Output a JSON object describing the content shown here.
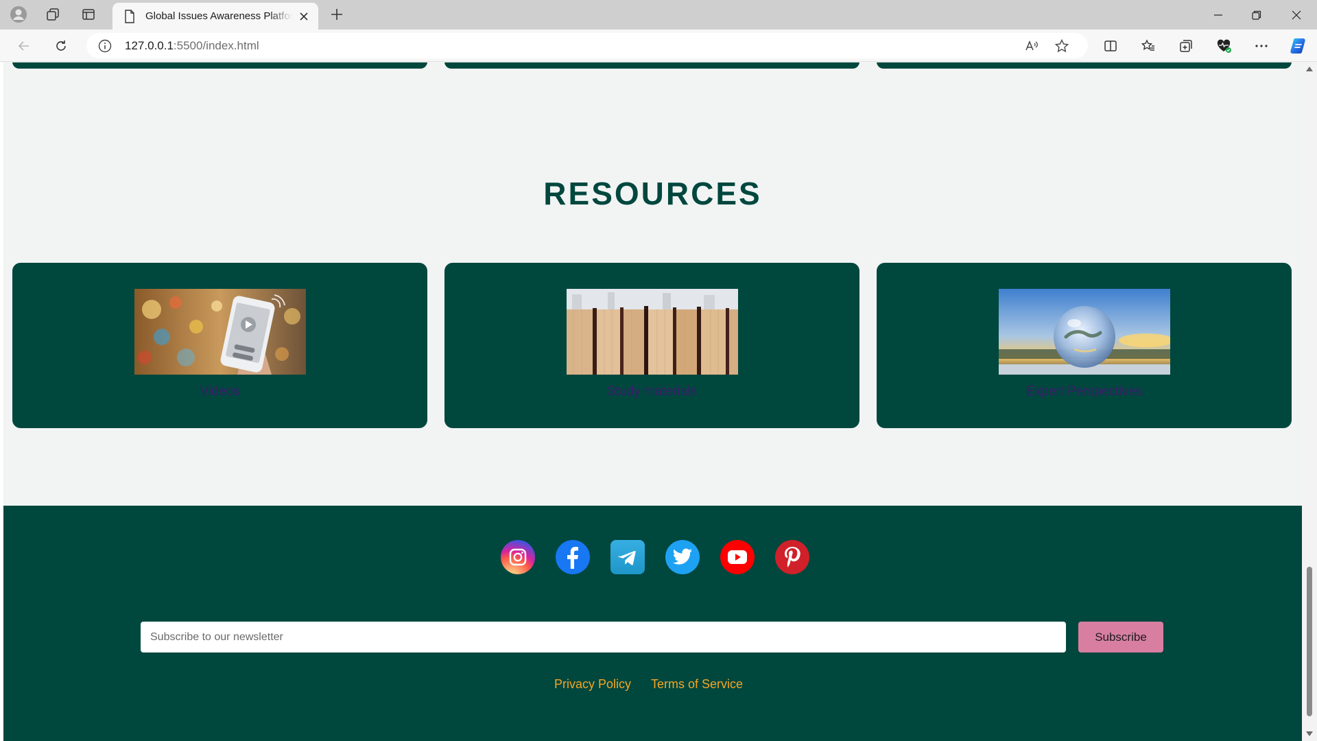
{
  "browser": {
    "tab_title": "Global Issues Awareness Platform",
    "url_host": "127.0.0.1",
    "url_rest": ":5500/index.html"
  },
  "resources": {
    "heading": "RESOURCES",
    "cards": [
      {
        "label": "Videos",
        "image": "phone-video-photo"
      },
      {
        "label": "Study materials",
        "image": "books-photo"
      },
      {
        "label": "Expert Perspectives",
        "image": "glass-globe-photo"
      }
    ]
  },
  "footer": {
    "social": [
      "instagram-icon",
      "facebook-icon",
      "telegram-icon",
      "twitter-icon",
      "youtube-icon",
      "pinterest-icon"
    ],
    "newsletter_placeholder": "Subscribe to our newsletter",
    "subscribe_label": "Subscribe",
    "links": [
      "Privacy Policy",
      "Terms of Service"
    ]
  },
  "colors": {
    "primary": "#00473e",
    "background": "#f1f4f3",
    "subscribe_button": "#d87fa1",
    "link": "#f6a623",
    "card_label": "#3b1c6a"
  }
}
